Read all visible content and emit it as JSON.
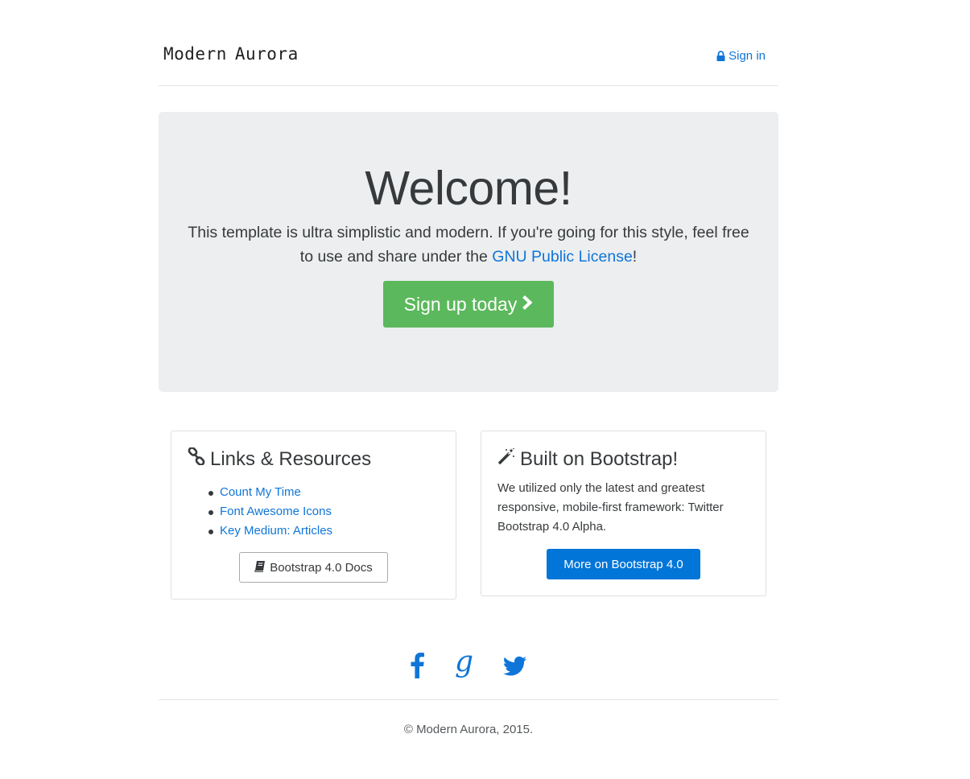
{
  "header": {
    "brand_word1": "Modern",
    "brand_word2": "Aurora",
    "signin_label": "Sign in",
    "signin_icon": "lock-icon"
  },
  "jumbotron": {
    "title": "Welcome!",
    "lead_text": "This template is ultra simplistic and modern. If you're going for this style, feel free to use and share under the ",
    "lead_link": "GNU Public License",
    "lead_end": "!",
    "signup_label": "Sign up today",
    "signup_icon": "chevron-right-icon"
  },
  "links_card": {
    "title": "Links & Resources",
    "icon": "chain-link-icon",
    "items": [
      {
        "label": "Count My Time"
      },
      {
        "label": "Font Awesome Icons"
      },
      {
        "label": "Key Medium: Articles"
      }
    ],
    "docs_button": "Bootstrap 4.0 Docs",
    "docs_icon": "book-icon"
  },
  "bootstrap_card": {
    "title": "Built on Bootstrap!",
    "icon": "magic-wand-icon",
    "text": "We utilized only the latest and greatest responsive, mobile-first framework: Twitter Bootstrap 4.0 Alpha.",
    "button": "More on Bootstrap 4.0"
  },
  "social": {
    "icons": [
      "facebook-icon",
      "google-icon",
      "twitter-icon"
    ]
  },
  "footer": {
    "copyright": "© Modern Aurora, 2015."
  },
  "colors": {
    "link": "#0f75d8",
    "success": "#5cb85c",
    "primary": "#0275d8",
    "jumbotron_bg": "#eceeef"
  }
}
